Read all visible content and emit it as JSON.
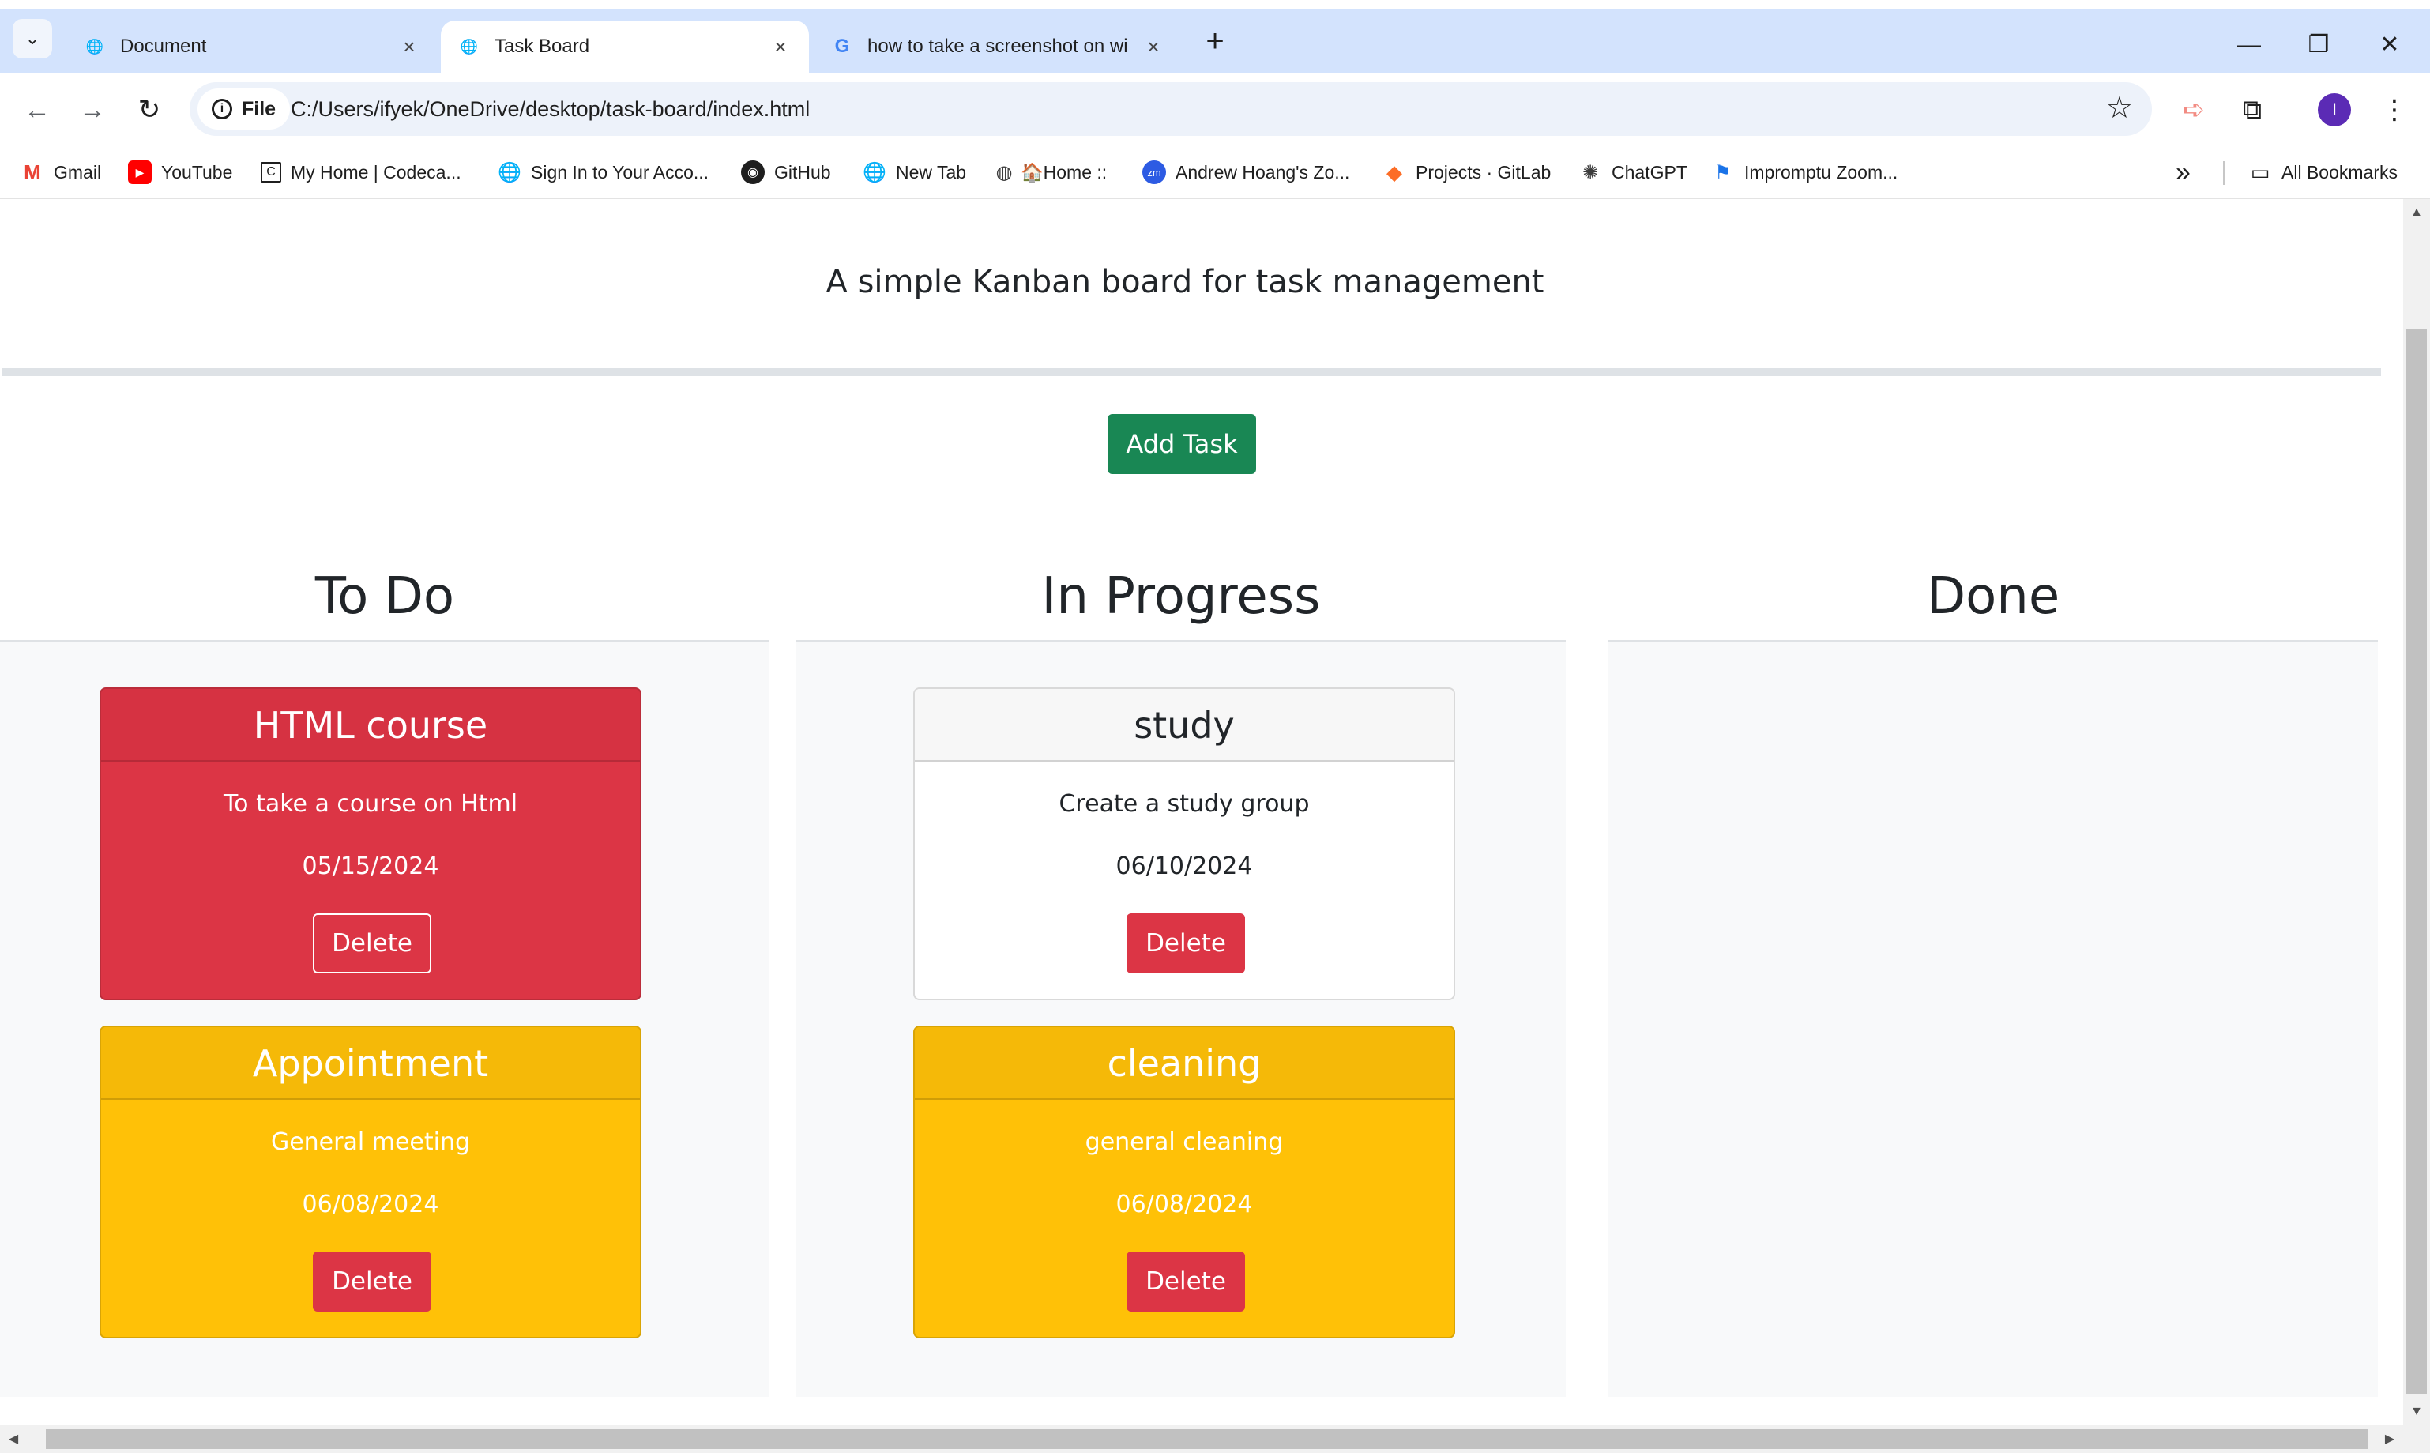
{
  "browser": {
    "tabs": [
      {
        "title": "Document",
        "active": false
      },
      {
        "title": "Task Board",
        "active": true
      },
      {
        "title": "how to take a screenshot on wi",
        "active": false
      }
    ],
    "tab_close_glyph": "×",
    "new_tab_glyph": "+",
    "window_controls": {
      "minimize": "—",
      "restore": "❐",
      "close": "✕"
    },
    "omnibox": {
      "chip_label": "File",
      "url": "C:/Users/ifyek/OneDrive/desktop/task-board/index.html"
    },
    "profile_initial": "I",
    "bookmarks": [
      {
        "label": "Gmail",
        "icon": "gmail-icon",
        "color": "#ea4335"
      },
      {
        "label": "YouTube",
        "icon": "youtube-icon",
        "color": "#ff0000"
      },
      {
        "label": "My Home | Codeca...",
        "icon": "codecademy-icon",
        "color": "#1f1f1f"
      },
      {
        "label": "Sign In to Your Acco...",
        "icon": "globe-icon",
        "color": "#5f6368"
      },
      {
        "label": "GitHub",
        "icon": "github-icon",
        "color": "#1f1f1f"
      },
      {
        "label": "New Tab",
        "icon": "globe-icon",
        "color": "#5f6368"
      },
      {
        "label": "🏠Home ::",
        "icon": "site-icon",
        "color": "#3c3c3c"
      },
      {
        "label": "Andrew Hoang's Zo...",
        "icon": "zoom-icon",
        "color": "#2d5be3"
      },
      {
        "label": "Projects · GitLab",
        "icon": "gitlab-icon",
        "color": "#fc6d26"
      },
      {
        "label": "ChatGPT",
        "icon": "chatgpt-icon",
        "color": "#3c3c3c"
      },
      {
        "label": "Impromptu Zoom...",
        "icon": "zoom-flag-icon",
        "color": "#1a73e8"
      }
    ],
    "overflow_glyph": "»",
    "all_bookmarks": "All Bookmarks"
  },
  "page": {
    "title": "Task Board",
    "subtitle": "A simple Kanban board for task management",
    "add_task_label": "Add Task",
    "lanes": [
      {
        "title": "To Do",
        "cards": [
          {
            "title": "HTML course",
            "description": "To take a course on Html",
            "date": "05/15/2024",
            "delete_label": "Delete",
            "status": "overdue",
            "color": "#dc3545"
          },
          {
            "title": "Appointment",
            "description": "General meeting",
            "date": "06/08/2024",
            "delete_label": "Delete",
            "status": "due-soon",
            "color": "#ffc107"
          }
        ]
      },
      {
        "title": "In Progress",
        "cards": [
          {
            "title": "study",
            "description": "Create a study group",
            "date": "06/10/2024",
            "delete_label": "Delete",
            "status": "normal",
            "color": "#ffffff"
          },
          {
            "title": "cleaning",
            "description": "general cleaning",
            "date": "06/08/2024",
            "delete_label": "Delete",
            "status": "due-soon",
            "color": "#ffc107"
          }
        ]
      },
      {
        "title": "Done",
        "cards": []
      }
    ]
  },
  "colors": {
    "success": "#198754",
    "danger": "#dc3545",
    "warning": "#ffc107",
    "tabstrip": "#d3e3fd"
  }
}
